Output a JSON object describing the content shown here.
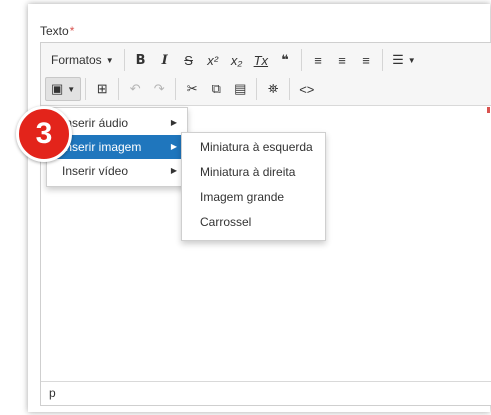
{
  "field": {
    "label": "Texto",
    "required_mark": "*"
  },
  "toolbar": {
    "formats_label": "Formatos",
    "bold": "B",
    "italic": "I",
    "strikethrough": "S",
    "superscript": "x²",
    "subscript": "x₂",
    "clear_format": "Tx",
    "blockquote": "❝",
    "align_left": "≡",
    "align_center": "≡",
    "align_right": "≡",
    "bullet_list": "☰",
    "media": "▣",
    "find": "⊞",
    "undo": "↶",
    "redo": "↷",
    "cut": "✂",
    "copy": "⧉",
    "paste": "▤",
    "search": "⛯",
    "source": "<>"
  },
  "media_menu": {
    "items": [
      {
        "label": "Inserir áudio",
        "has_submenu": true
      },
      {
        "label": "Inserir imagem",
        "has_submenu": true,
        "selected": true
      },
      {
        "label": "Inserir vídeo",
        "has_submenu": true
      }
    ]
  },
  "image_submenu": {
    "items": [
      {
        "label": "Miniatura à esquerda"
      },
      {
        "label": "Miniatura à direita"
      },
      {
        "label": "Imagem grande"
      },
      {
        "label": "Carrossel"
      }
    ]
  },
  "statusbar": {
    "path": "p"
  },
  "badge": {
    "number": "3",
    "color": "#e3241b"
  },
  "colors": {
    "selection": "#1f76bd",
    "required": "#d9534f"
  }
}
